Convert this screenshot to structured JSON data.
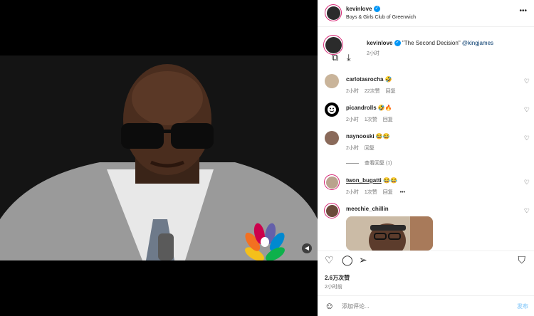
{
  "header": {
    "username": "kevinlove",
    "location": "Boys & Girls Club of Greenwich"
  },
  "caption": {
    "username": "kevinlove",
    "text": "\"The Second Decision\"",
    "mention": "@kingjames",
    "time": "2小时"
  },
  "comments": [
    {
      "username": "carlotasrocha",
      "emoji": "🤣",
      "time": "2小时",
      "likes": "22次赞",
      "reply": "回复"
    },
    {
      "username": "picandrolls",
      "emoji": "🤣🔥",
      "time": "2小时",
      "likes": "1次赞",
      "reply": "回复"
    },
    {
      "username": "naynooski",
      "emoji": "😂😂",
      "time": "2小时",
      "likes": "",
      "reply": "回复",
      "view_replies": "查看回复 (1)"
    },
    {
      "username": "twon_bugatti",
      "emoji": "😂😂",
      "time": "2小时",
      "likes": "1次赞",
      "reply": "回复",
      "more": "•••"
    },
    {
      "username": "meechie_chillin",
      "emoji": "",
      "time": "",
      "likes": "",
      "reply": ""
    }
  ],
  "stats": {
    "likes": "2.6万次赞",
    "time": "2小时前"
  },
  "composer": {
    "placeholder": "添加评论...",
    "post_label": "发布"
  },
  "colors": {
    "accent": "#0095f6",
    "story_ring": "#d62976"
  }
}
